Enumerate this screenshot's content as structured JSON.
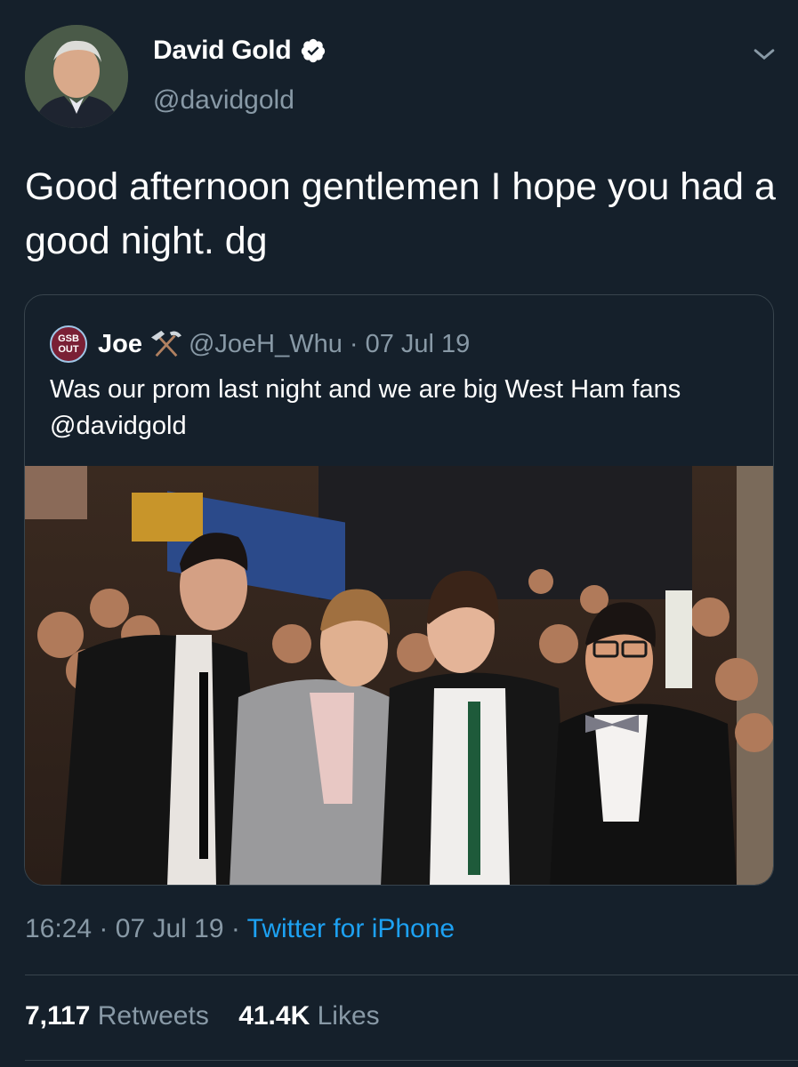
{
  "author": {
    "name": "David Gold",
    "handle": "@davidgold",
    "verified": true,
    "avatar_icon": "profile-photo"
  },
  "tweet": {
    "text": "Good afternoon gentlemen I hope you had a good night. dg",
    "time": "16:24",
    "date": "07 Jul 19",
    "source": "Twitter for iPhone",
    "separator": "·"
  },
  "quoted_tweet": {
    "avatar_text_top": "GSB",
    "avatar_text_bottom": "OUT",
    "name": "Joe",
    "name_emoji": "hammer-and-pick-icon",
    "handle": "@JoeH_Whu",
    "separator": "·",
    "date": "07 Jul 19",
    "text": "Was our prom last night and we are big West Ham fans @davidgold",
    "photo_icon": "group-photo"
  },
  "stats": {
    "retweets_count": "7,117",
    "retweets_label": "Retweets",
    "likes_count": "41.4K",
    "likes_label": "Likes"
  },
  "colors": {
    "background": "#15202b",
    "secondary_text": "#8899a6",
    "link": "#1da1f2",
    "border": "#38444d"
  }
}
